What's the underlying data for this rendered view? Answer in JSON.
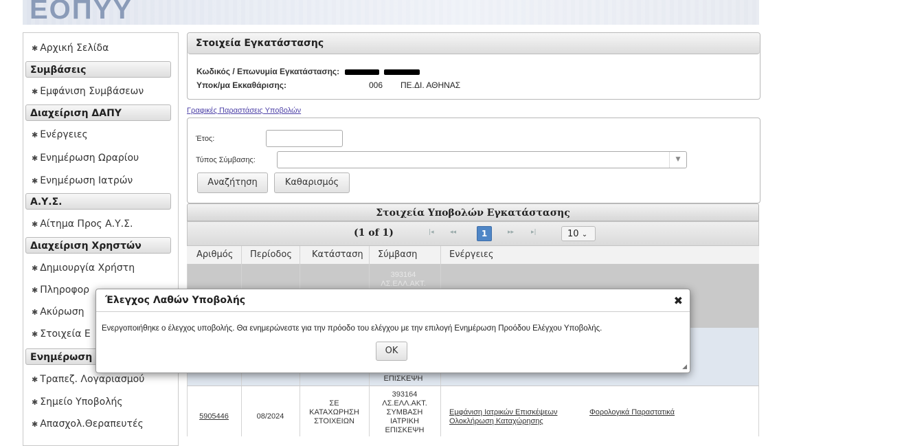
{
  "header": {
    "logo": "ΕΟΠΥΥ"
  },
  "sidebar": {
    "home": "Αρχική Σελίδα",
    "sections": [
      {
        "title": "Συμβάσεις",
        "items": [
          "Εμφάνιση Συμβάσεων"
        ]
      },
      {
        "title": "Διαχείριση ΔΑΠΥ",
        "items": [
          "Ενέργειες",
          "Ενημέρωση Ωραρίου",
          "Ενημέρωση Ιατρών"
        ]
      },
      {
        "title": "Α.Υ.Σ.",
        "items": [
          "Αίτημα Προς Α.Υ.Σ."
        ]
      },
      {
        "title": "Διαχείριση Χρηστών",
        "items": [
          "Δημιουργία Χρήστη",
          "Πληροφορ",
          "Ακύρωση",
          "Στοιχεία Ε"
        ]
      },
      {
        "title": "Ενημέρωση",
        "items": [
          "Τραπεζ. Λογαριασμού",
          "Σημείο Υποβολής",
          "Απασχολ.Θεραπευτές"
        ]
      }
    ]
  },
  "facility": {
    "title": "Στοιχεία Εγκατάστασης",
    "code_label": "Κωδικός / Επωνυμία Εγκατάστασης:",
    "dept_label": "Υποκ/μα Εκκαθάρισης:",
    "dept_code": "006",
    "dept_name": "ΠΕ.ΔΙ. ΑΘΗΝΑΣ"
  },
  "charts_link": "Γραφικές Παραστάσεις Υποβολών",
  "search": {
    "year_label": "Έτος:",
    "year_value": "",
    "contract_label": "Τύπος Σύμβασης:",
    "contract_value": "",
    "search_button": "Αναζήτηση",
    "clear_button": "Καθαρισμός"
  },
  "grid": {
    "title": "Στοιχεία Υποβολών Εγκατάστασης",
    "pager_text": "(1 of 1)",
    "current_page": "1",
    "page_size": "10",
    "columns": [
      "Αριθμός",
      "Περίοδος",
      "Κατάσταση",
      "Σύμβαση",
      "Ενέργειες"
    ],
    "row1_contract_partial": [
      "393164",
      "ΛΣ.ΕΛΛ.ΑΚΤ."
    ],
    "row2_contract_partial": "ΕΠΙΣΚΕΨΗ",
    "row3": {
      "number": "5905446",
      "period": "08/2024",
      "status": [
        "ΣΕ",
        "ΚΑΤΑΧΩΡΗΣΗ",
        "ΣΤΟΙΧΕΙΩΝ"
      ],
      "contract": [
        "393164",
        "ΛΣ.ΕΛΛ.ΑΚΤ.",
        "ΣΥΜΒΑΣΗ",
        "ΙΑΤΡΙΚΗ",
        "ΕΠΙΣΚΕΨΗ"
      ],
      "actions": [
        "Εμφάνιση Ιατρικών Επισκέψεων",
        "Φορολογικά Παραστατικά",
        "Ολοκλήρωση Καταχώρησης"
      ]
    }
  },
  "dialog": {
    "title": "Έλεγχος Λαθών Υποβολής",
    "message": "Ενεργοποιήθηκε ο έλεγχος υποβολής. Θα ενημερώνεστε για την πρόοδο του ελέγχου με την επιλογή Ενημέρωση Προόδου Ελέγχου Υποβολής.",
    "ok": "OK"
  },
  "icons": {
    "gear": "gear-icon",
    "close": "close-icon",
    "dropdown": "chevron-down-icon",
    "resize": "resize-handle-icon"
  },
  "colors": {
    "pager_current": "#4f86c6",
    "link": "#4b3fa6"
  }
}
